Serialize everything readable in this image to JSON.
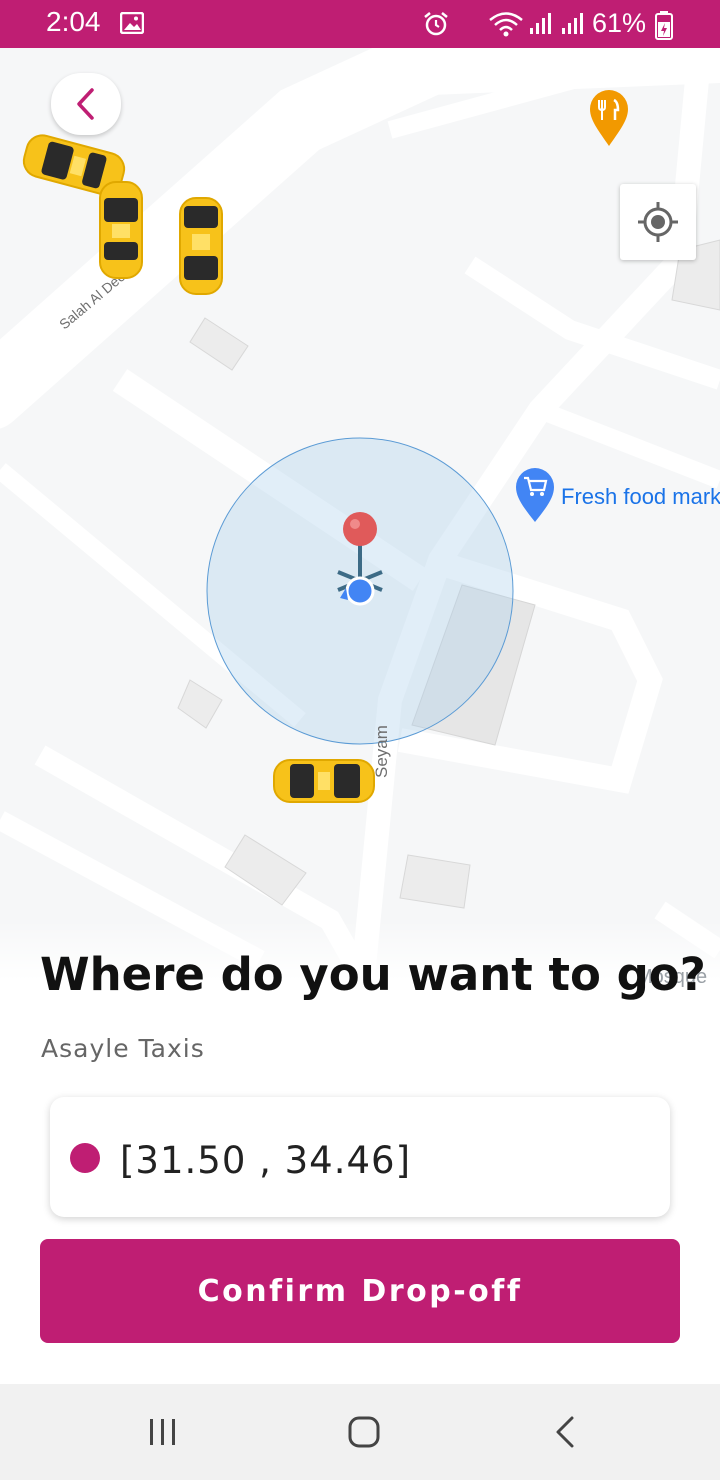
{
  "status_bar": {
    "time": "2:04",
    "battery_percent": "61%",
    "background_color": "#bf1e73",
    "icons": [
      "image-icon",
      "alarm-icon",
      "wifi-icon",
      "signal-icon",
      "signal-icon",
      "battery-icon"
    ]
  },
  "map": {
    "street_labels": [
      "Salah Al Deen",
      "Seyam"
    ],
    "poi": {
      "label": "Fresh food mark",
      "icon": "shopping-cart-pin-icon"
    },
    "mosque_label": "Mosque",
    "restaurant_icon": "restaurant-pin-icon",
    "back_icon": "chevron-left-icon",
    "locate_icon": "my-location-icon",
    "taxi_icon": "taxi-icon",
    "taxi_count": 4
  },
  "sheet": {
    "title": "Where do you want to go?",
    "subtitle": "Asayle Taxis",
    "location_value": "[31.50 , 34.46]",
    "confirm_label": "Confirm Drop-off",
    "accent_color": "#bf1e73"
  },
  "nav_bar": {
    "icons": [
      "recent-apps-icon",
      "home-icon",
      "back-icon"
    ]
  }
}
